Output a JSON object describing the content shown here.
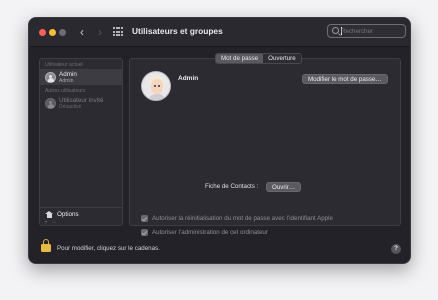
{
  "window": {
    "title": "Utilisateurs et groupes",
    "search": {
      "placeholder": "Rechercher",
      "value": ""
    }
  },
  "sidebar": {
    "section_current": "Utilisateur actuel",
    "current_user": {
      "name": "Admin",
      "role": "Admin"
    },
    "section_others": "Autres utilisateurs",
    "other_users": [
      {
        "name": "Utilisateur invité",
        "status": "Désactivé"
      }
    ],
    "options_label": "Options",
    "add_symbol": "+",
    "remove_symbol": "−"
  },
  "tabs": [
    {
      "label": "Mot de passe",
      "active": true
    },
    {
      "label": "Ouverture",
      "active": false
    }
  ],
  "main": {
    "username": "Admin",
    "change_password_label": "Modifier le mot de passe…",
    "contacts_label": "Fiche de Contacts :",
    "open_label": "Ouvrir…",
    "checkboxes": [
      {
        "label": "Autoriser la réinitialisation du mot de passe avec l’identifiant Apple",
        "checked": true,
        "enabled": false
      },
      {
        "label": "Autoriser l’administration de cet ordinateur",
        "checked": true,
        "enabled": false
      }
    ]
  },
  "footer": {
    "lock_label": "Pour modifier, cliquez sur le cadenas.",
    "help_symbol": "?"
  },
  "colors": {
    "window_bg": "#232228",
    "panel_bg": "#2c2b31",
    "lock": "#e8b93c",
    "close": "#ff5f57",
    "minimize": "#febc2e"
  }
}
